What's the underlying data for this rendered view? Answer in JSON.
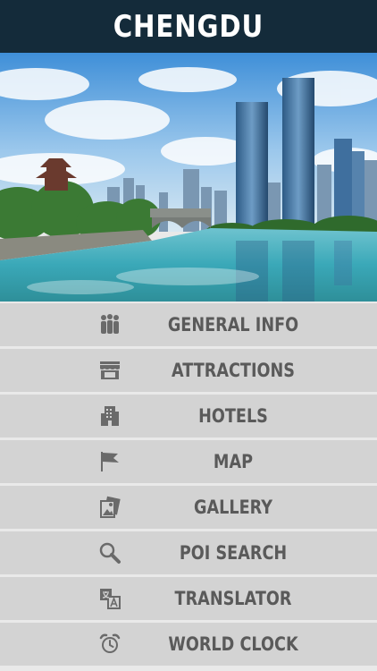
{
  "header": {
    "title": "CHENGDU"
  },
  "hero": {
    "image": "chengdu-river-skyline-photo"
  },
  "menu": {
    "items": [
      {
        "label": "GENERAL INFO",
        "icon": "people-group-icon"
      },
      {
        "label": "ATTRACTIONS",
        "icon": "storefront-icon"
      },
      {
        "label": "HOTELS",
        "icon": "building-icon"
      },
      {
        "label": "MAP",
        "icon": "flag-icon"
      },
      {
        "label": "GALLERY",
        "icon": "photos-icon"
      },
      {
        "label": "POI SEARCH",
        "icon": "magnifier-icon"
      },
      {
        "label": "TRANSLATOR",
        "icon": "translate-icon"
      },
      {
        "label": "WORLD CLOCK",
        "icon": "alarm-clock-icon"
      }
    ]
  },
  "colors": {
    "header_bg": "#142b3a",
    "menu_item_bg": "#d3d3d3",
    "menu_text": "#5a5a5a",
    "icon": "#6a6a6a"
  }
}
